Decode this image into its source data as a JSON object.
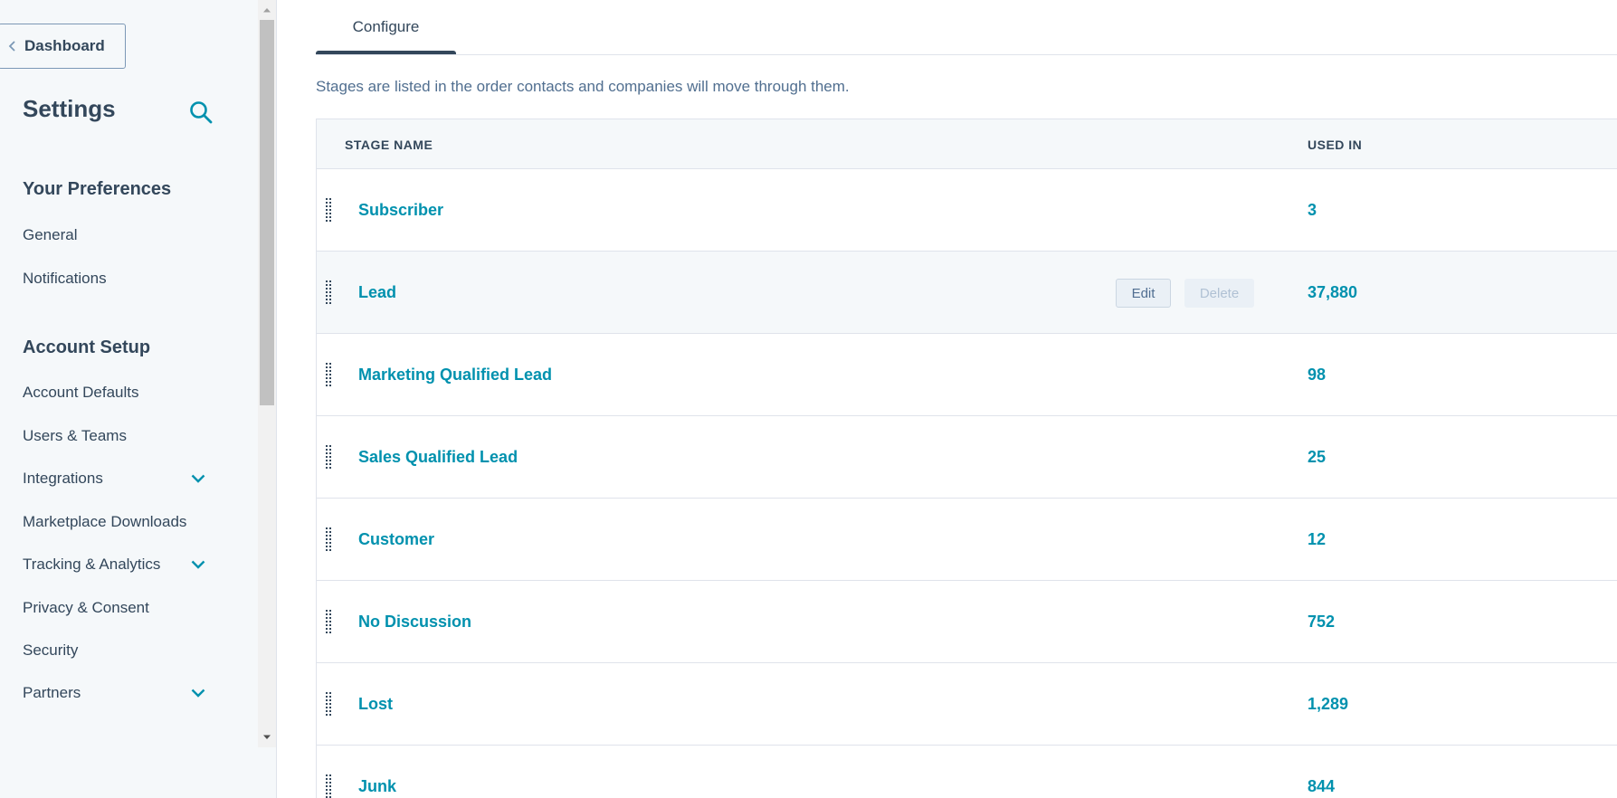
{
  "sidebar": {
    "back_label": "Dashboard",
    "title": "Settings",
    "sections": [
      {
        "heading": "Your Preferences",
        "items": [
          {
            "label": "General"
          },
          {
            "label": "Notifications"
          }
        ]
      },
      {
        "heading": "Account Setup",
        "items": [
          {
            "label": "Account Defaults"
          },
          {
            "label": "Users & Teams"
          },
          {
            "label": "Integrations"
          },
          {
            "label": "Marketplace Downloads"
          },
          {
            "label": "Tracking & Analytics"
          },
          {
            "label": "Privacy & Consent"
          },
          {
            "label": "Security"
          },
          {
            "label": "Partners"
          }
        ]
      }
    ]
  },
  "main": {
    "tabs": [
      {
        "label": "Configure",
        "active": true
      }
    ],
    "description": "Stages are listed in the order contacts and companies will move through them.",
    "table": {
      "columns": [
        "STAGE NAME",
        "USED IN"
      ],
      "rows": [
        {
          "name": "Subscriber",
          "used_in": "3"
        },
        {
          "name": "Lead",
          "used_in": "37,880"
        },
        {
          "name": "Marketing Qualified Lead",
          "used_in": "98"
        },
        {
          "name": "Sales Qualified Lead",
          "used_in": "25"
        },
        {
          "name": "Customer",
          "used_in": "12"
        },
        {
          "name": "No Discussion",
          "used_in": "752"
        },
        {
          "name": "Lost",
          "used_in": "1,289"
        },
        {
          "name": "Junk",
          "used_in": "844"
        }
      ],
      "row_actions": {
        "edit_label": "Edit",
        "delete_label": "Delete"
      }
    }
  },
  "colors": {
    "accent": "#0091ae",
    "text": "#33475b",
    "sidebar_bg": "#f5f8fa"
  }
}
